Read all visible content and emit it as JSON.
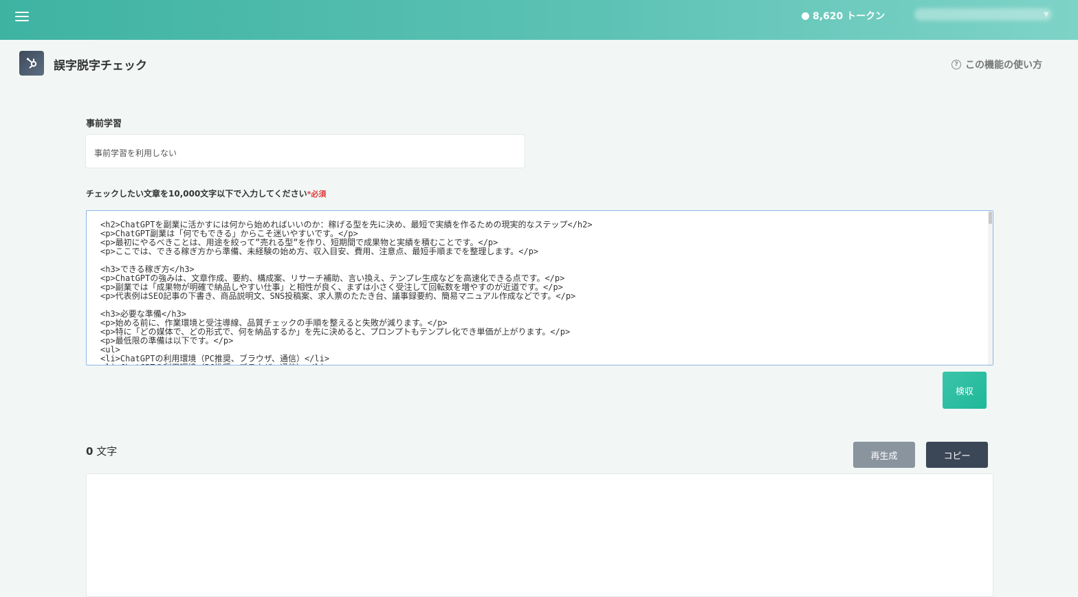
{
  "header": {
    "tokens_label": "8,620 トークン",
    "email_label": "",
    "colors": {
      "topbar_start": "#3fb3a3",
      "topbar_end": "#7ed3c7"
    }
  },
  "page": {
    "title": "誤字脱字チェック",
    "help_label": "この機能の使い方",
    "help_icon": "question-circle-icon",
    "title_icon": "hubspot-icon"
  },
  "form": {
    "pretraining_label": "事前学習",
    "pretraining_value": "事前学習を利用しない",
    "input_label": "チェックしたい文章を10,000文字以下で入力してください",
    "required_label": "*必須",
    "input_lines": [
      "<h2>ChatGPTを副業に活かすには何から始めればいいのか：稼げる型を先に決め、最短で実績を作るための現実的なステップ</h2>",
      "<p>ChatGPT副業は「何でもできる」からこそ迷いやすいです。</p>",
      "<p>最初にやるべきことは、用途を絞って”売れる型”を作り、短期間で成果物と実績を積むことです。</p>",
      "<p>ここでは、できる稼ぎ方から準備、未経験の始め方、収入目安、費用、注意点、最短手順までを整理します。</p>",
      "",
      "<h3>できる稼ぎ方</h3>",
      "<p>ChatGPTの強みは、文章作成、要約、構成案、リサーチ補助、言い換え、テンプレ生成などを高速化できる点です。</p>",
      "<p>副業では「成果物が明確で納品しやすい仕事」と相性が良く、まずは小さく受注して回転数を増やすのが近道です。</p>",
      "<p>代表例はSEO記事の下書き、商品説明文、SNS投稿案、求人票のたたき台、議事録要約、簡易マニュアル作成などです。</p>",
      "",
      "<h3>必要な準備</h3>",
      "<p>始める前に、作業環境と受注導線、品質チェックの手順を整えると失敗が減ります。</p>",
      "<p>特に「どの媒体で、どの形式で、何を納品するか」を先に決めると、プロンプトもテンプレ化でき単価が上がります。</p>",
      "<p>最低限の準備は以下です。</p>",
      "<ul>",
      "<li>ChatGPTの利用環境（PC推奨、ブラウザ、通信）</li>",
      "<li>ChatGPTの利用環境（PC推奨、ブラウザ、通信）</li>"
    ],
    "submit_label": "検収"
  },
  "result": {
    "count_value": "0",
    "count_unit": "文字",
    "regenerate_label": "再生成",
    "copy_label": "コピー"
  }
}
